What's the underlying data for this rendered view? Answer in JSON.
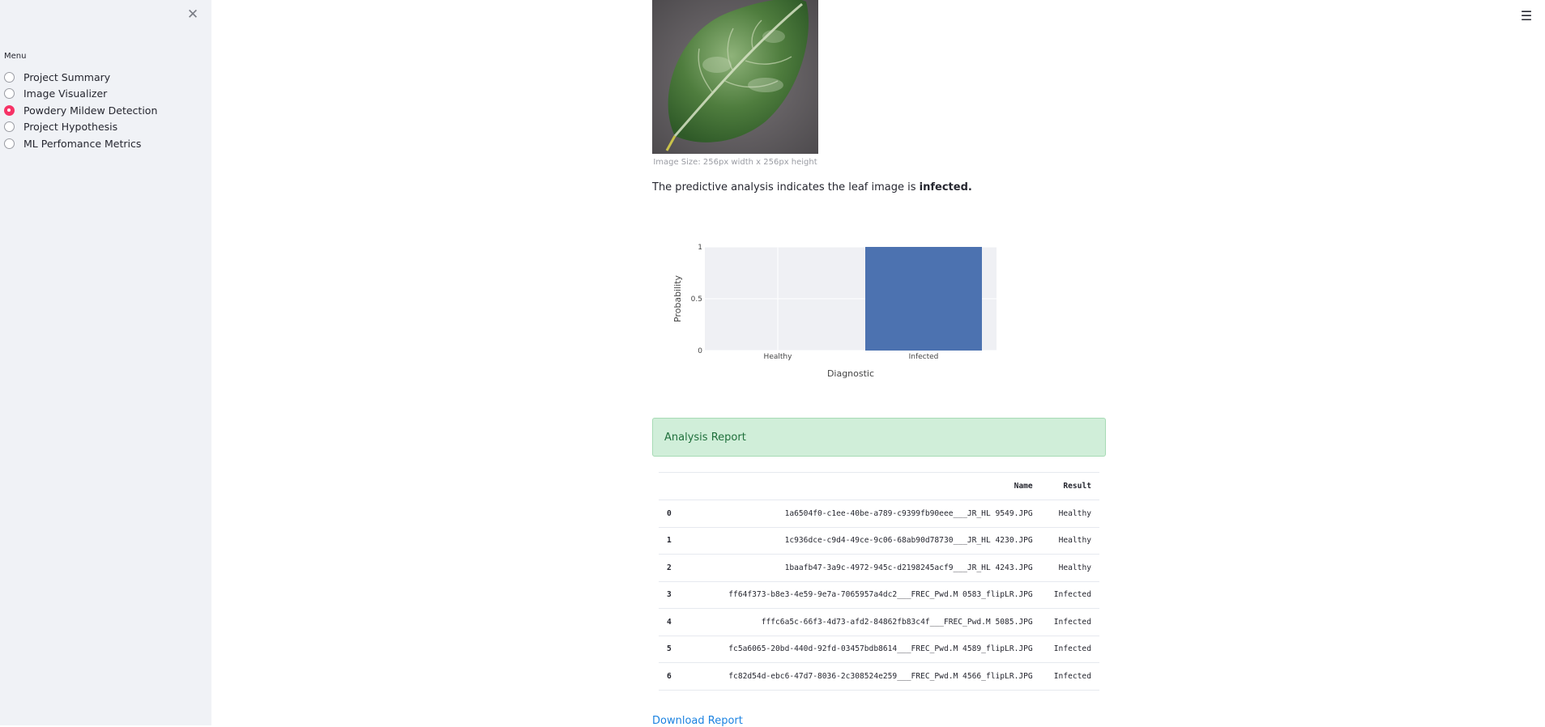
{
  "sidebar": {
    "menu_label": "Menu",
    "items": [
      {
        "label": "Project Summary",
        "selected": false
      },
      {
        "label": "Image Visualizer",
        "selected": false
      },
      {
        "label": "Powdery Mildew Detection",
        "selected": true
      },
      {
        "label": "Project Hypothesis",
        "selected": false
      },
      {
        "label": "ML Perfomance Metrics",
        "selected": false
      }
    ],
    "close_icon": "close-icon"
  },
  "header": {
    "menu_icon": "hamburger-menu-icon"
  },
  "main": {
    "image_caption": "Image Size: 256px width x 256px height",
    "prediction_text": "The predictive analysis indicates the leaf image is ",
    "prediction_result": "infected.",
    "report_title": "Analysis Report",
    "download_link": "Download Report"
  },
  "chart_data": {
    "type": "bar",
    "categories": [
      "Healthy",
      "Infected"
    ],
    "values": [
      0,
      1
    ],
    "xlabel": "Diagnostic",
    "ylabel": "Probability",
    "ylim": [
      0,
      1
    ],
    "yticks": [
      "0",
      "0.5",
      "1"
    ],
    "bar_color": "#4c72b0",
    "plot_bg": "#eff0f4",
    "grid": true
  },
  "table": {
    "columns": [
      "",
      "Name",
      "Result"
    ],
    "rows": [
      {
        "index": "0",
        "name": "1a6504f0-c1ee-40be-a789-c9399fb90eee___JR_HL 9549.JPG",
        "result": "Healthy"
      },
      {
        "index": "1",
        "name": "1c936dce-c9d4-49ce-9c06-68ab90d78730___JR_HL 4230.JPG",
        "result": "Healthy"
      },
      {
        "index": "2",
        "name": "1baafb47-3a9c-4972-945c-d2198245acf9___JR_HL 4243.JPG",
        "result": "Healthy"
      },
      {
        "index": "3",
        "name": "ff64f373-b8e3-4e59-9e7a-7065957a4dc2___FREC_Pwd.M 0583_flipLR.JPG",
        "result": "Infected"
      },
      {
        "index": "4",
        "name": "fffc6a5c-66f3-4d73-afd2-84862fb83c4f___FREC_Pwd.M 5085.JPG",
        "result": "Infected"
      },
      {
        "index": "5",
        "name": "fc5a6065-20bd-440d-92fd-03457bdb8614___FREC_Pwd.M 4589_flipLR.JPG",
        "result": "Infected"
      },
      {
        "index": "6",
        "name": "fc82d54d-ebc6-47d7-8036-2c308524e259___FREC_Pwd.M 4566_flipLR.JPG",
        "result": "Infected"
      }
    ]
  }
}
